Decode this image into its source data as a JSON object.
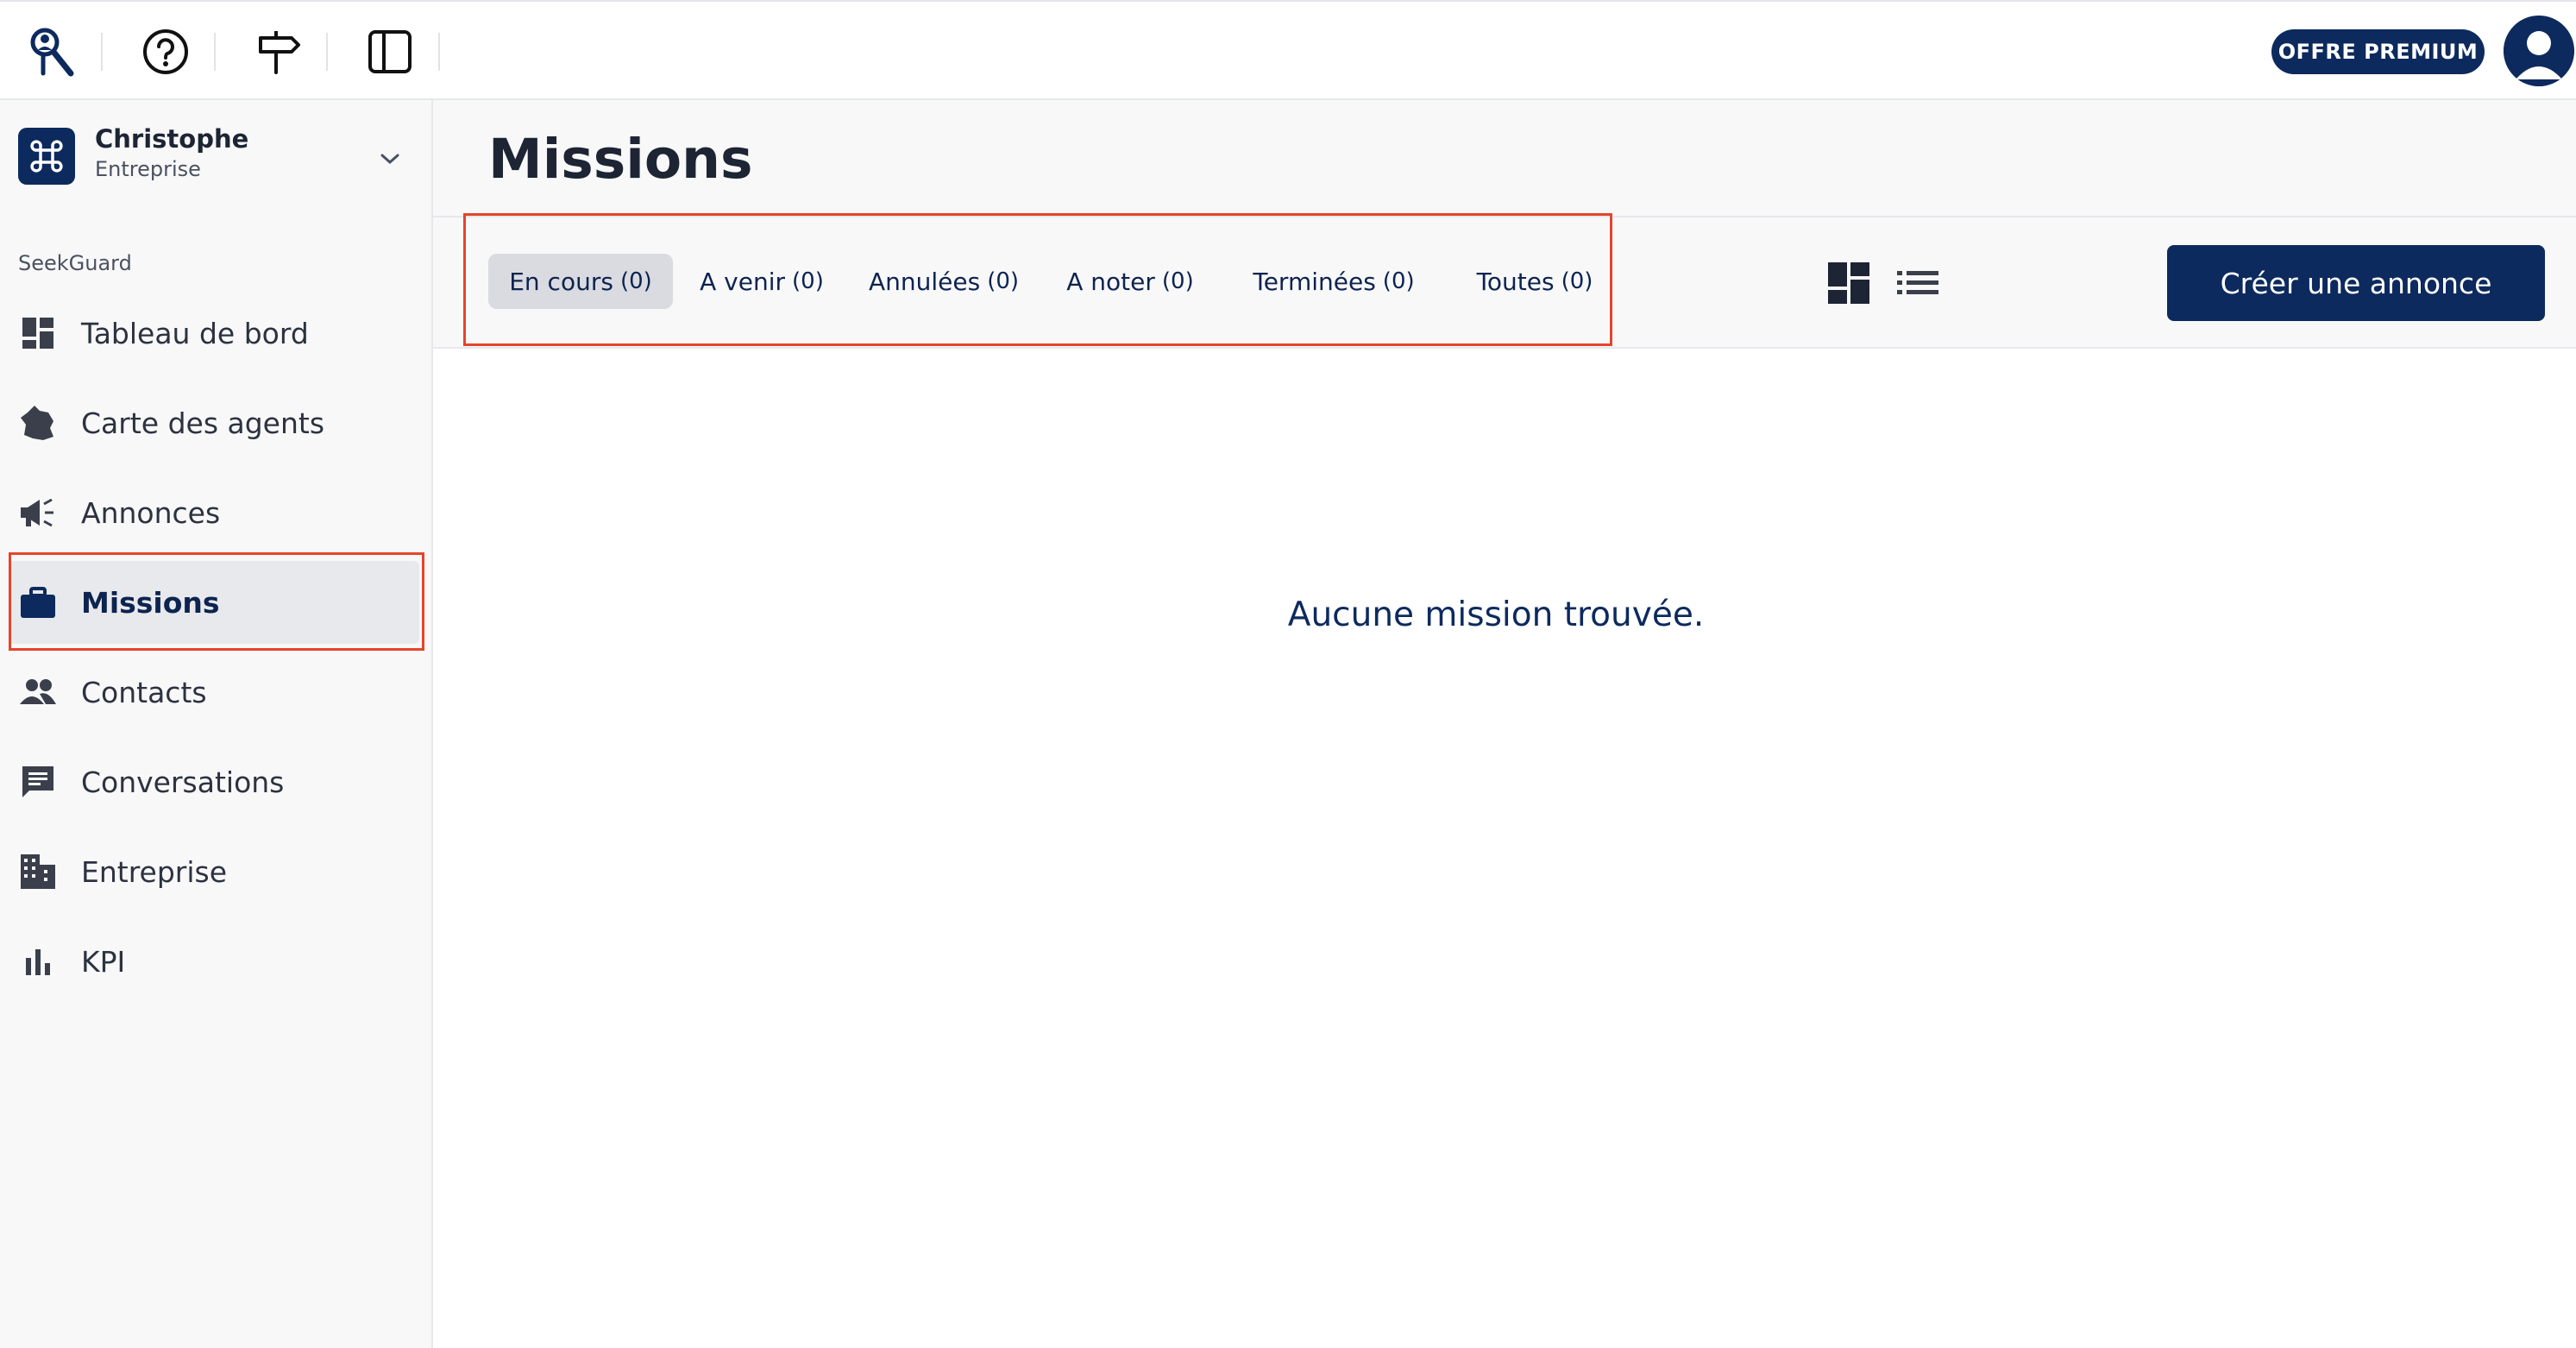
{
  "topbar": {
    "icons": [
      "app-logo-icon",
      "help-icon",
      "signpost-icon",
      "sidebar-toggle-icon"
    ],
    "premium_label": "OFFRE PREMIUM",
    "avatar_icon": "user-avatar-icon"
  },
  "sidebar": {
    "org": {
      "name": "Christophe",
      "type": "Entreprise",
      "logo_icon": "command-icon"
    },
    "section_label": "SeekGuard",
    "items": [
      {
        "label": "Tableau de bord",
        "icon": "dashboard-icon"
      },
      {
        "label": "Carte des agents",
        "icon": "france-map-icon"
      },
      {
        "label": "Annonces",
        "icon": "megaphone-icon"
      },
      {
        "label": "Missions",
        "icon": "briefcase-icon",
        "active": true
      },
      {
        "label": "Contacts",
        "icon": "people-icon"
      },
      {
        "label": "Conversations",
        "icon": "chat-icon"
      },
      {
        "label": "Entreprise",
        "icon": "building-icon"
      },
      {
        "label": "KPI",
        "icon": "bar-chart-icon"
      }
    ]
  },
  "main": {
    "title": "Missions",
    "tabs": [
      {
        "label": "En cours",
        "count": "(0)",
        "active": true
      },
      {
        "label": "A venir",
        "count": "(0)"
      },
      {
        "label": "Annulées",
        "count": "(0)"
      },
      {
        "label": "A noter",
        "count": "(0)"
      },
      {
        "label": "Terminées",
        "count": "(0)"
      },
      {
        "label": "Toutes",
        "count": "(0)"
      }
    ],
    "view_icons": [
      "grid-view-icon",
      "list-view-icon"
    ],
    "create_label": "Créer une annonce",
    "empty_message": "Aucune mission trouvée."
  },
  "colors": {
    "brand": "#0d2a5e",
    "highlight": "#e5442b",
    "active_tab": "#d9dbe0",
    "sidebar_bg": "#f8f8f9"
  }
}
